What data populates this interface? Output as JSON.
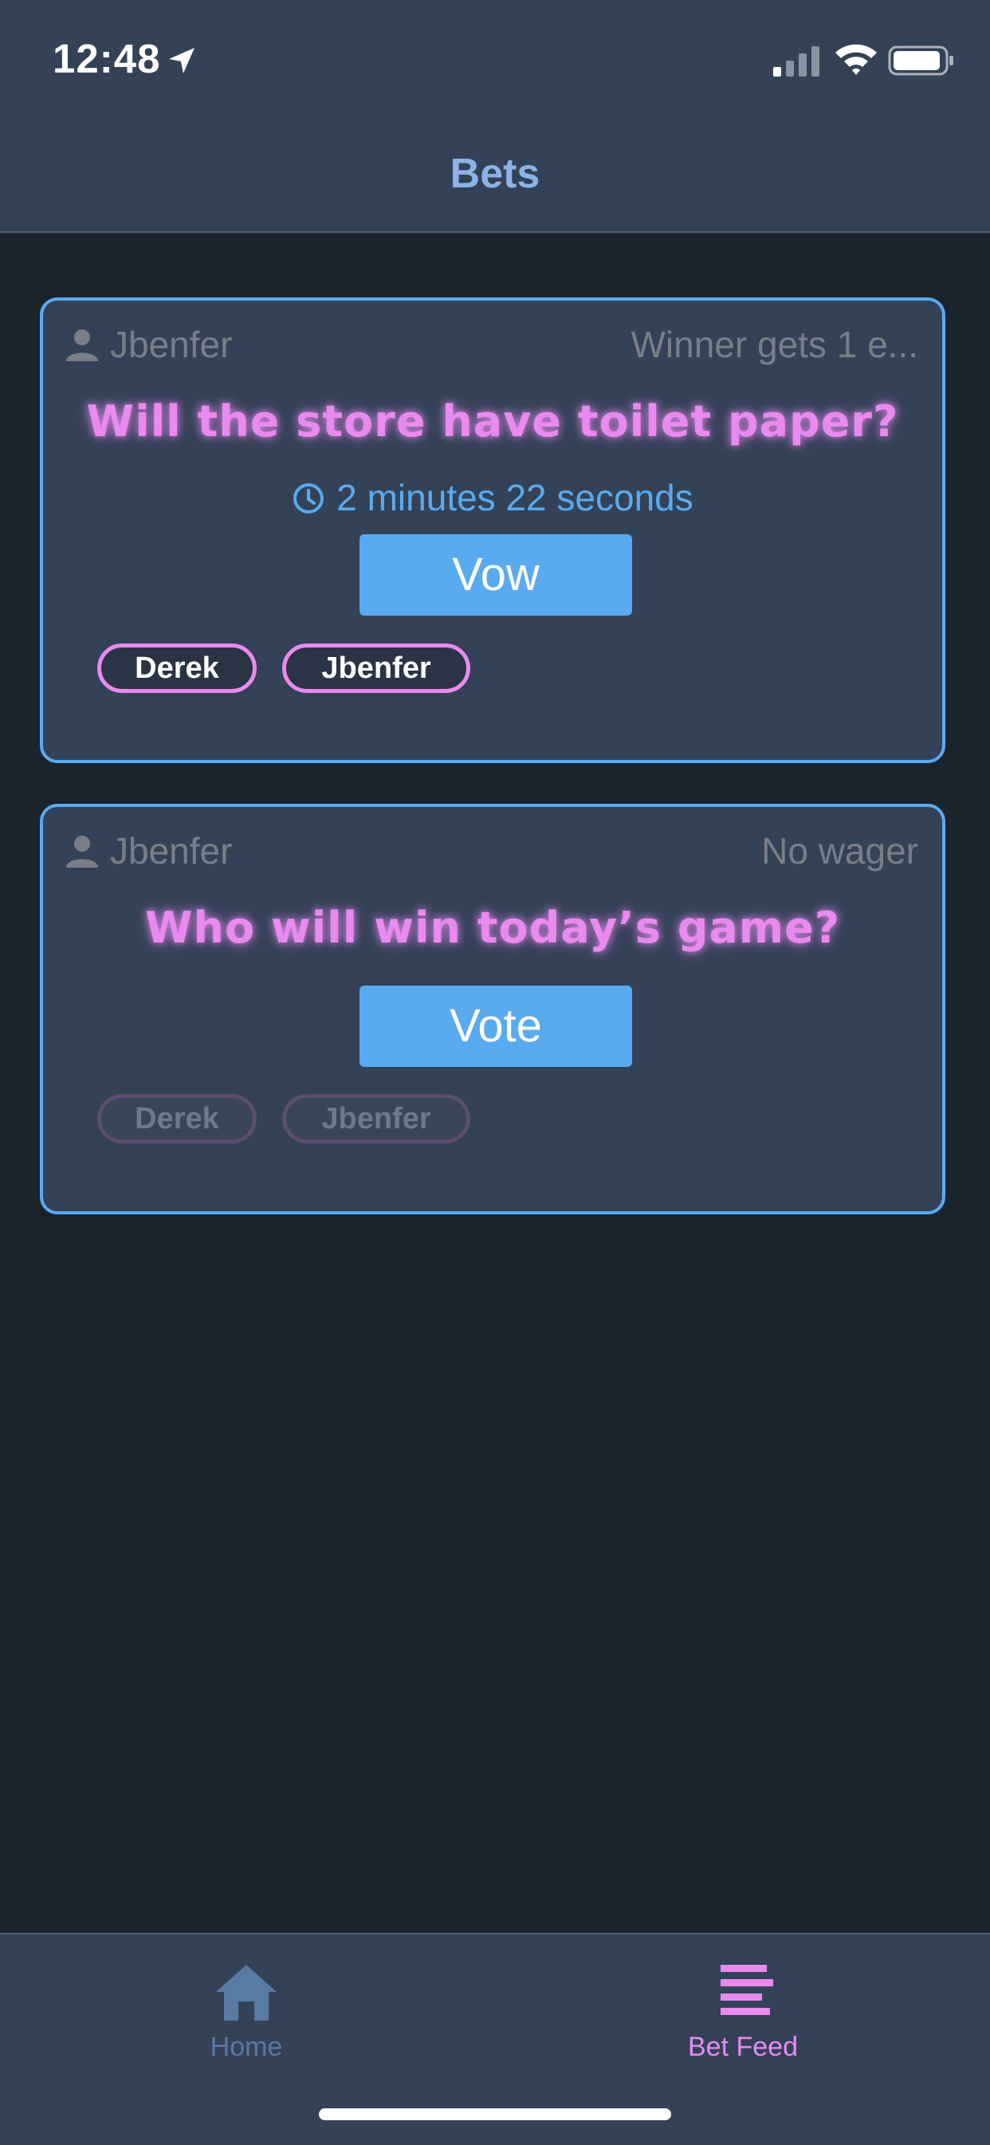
{
  "status_bar": {
    "time": "12:48"
  },
  "header": {
    "title": "Bets"
  },
  "bets": [
    {
      "author": "Jbenfer",
      "wager": "Winner gets 1 e...",
      "question": "Will the store have toilet paper?",
      "timer": "2 minutes  22 seconds",
      "button_label": "Vow",
      "options": [
        "Derek",
        "Jbenfer"
      ]
    },
    {
      "author": "Jbenfer",
      "wager": "No wager",
      "question": "Who will win today’s game?",
      "button_label": "Vote",
      "options": [
        "Derek",
        "Jbenfer"
      ]
    }
  ],
  "tabbar": {
    "home_label": "Home",
    "feed_label": "Bet Feed",
    "active": "Bet Feed"
  },
  "colors": {
    "background": "#1b232d",
    "panel": "#334257",
    "accent_blue": "#5aaaf0",
    "accent_pink": "#e98af0"
  }
}
